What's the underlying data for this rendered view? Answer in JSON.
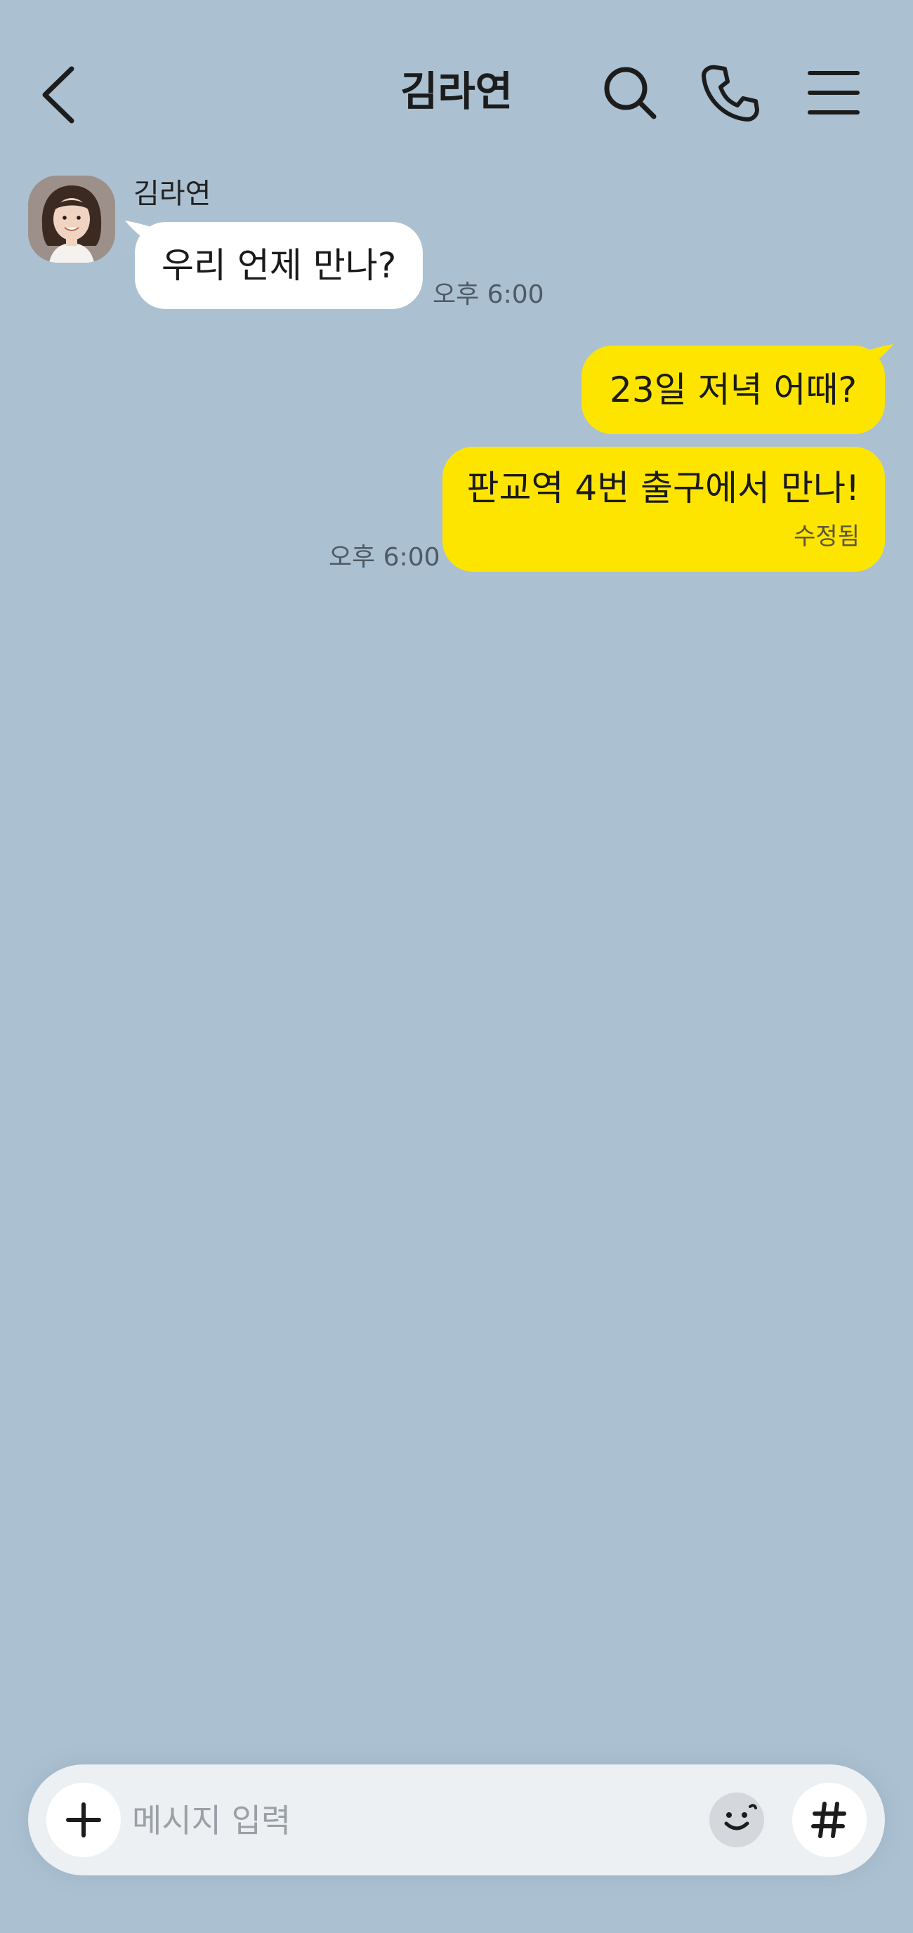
{
  "header": {
    "title": "김라연",
    "back_icon": "chevron-left-icon",
    "search_icon": "search-icon",
    "call_icon": "phone-icon",
    "menu_icon": "hamburger-menu-icon"
  },
  "messages": [
    {
      "direction": "incoming",
      "sender": "김라연",
      "text": "우리 언제 만나?",
      "time": "오후 6:00"
    },
    {
      "direction": "outgoing",
      "text": "23일 저녁 어때?"
    },
    {
      "direction": "outgoing",
      "text": "판교역 4번 출구에서 만나!",
      "edited_label": "수정됨",
      "time": "오후 6:00"
    }
  ],
  "input": {
    "placeholder": "메시지 입력",
    "value": "",
    "plus_icon": "plus-icon",
    "emoji_icon": "emoji-icon",
    "hash_icon": "hash-icon"
  },
  "colors": {
    "background": "#abc1d1",
    "incoming_bubble": "#ffffff",
    "outgoing_bubble": "#fee500",
    "input_bar": "#ecf0f3"
  }
}
